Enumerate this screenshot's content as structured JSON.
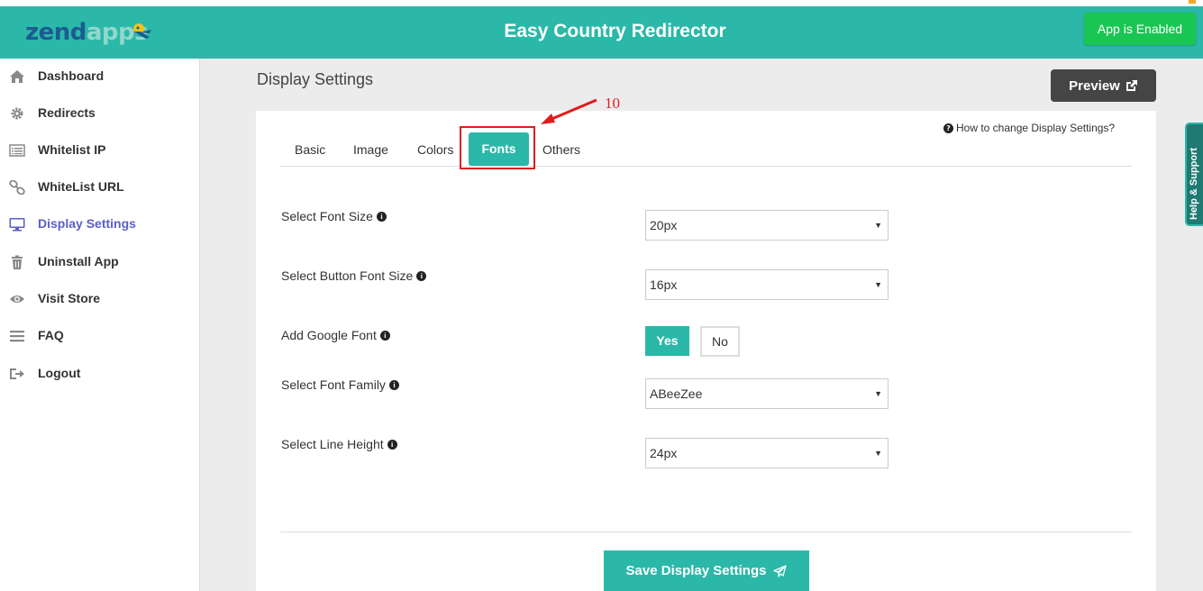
{
  "header": {
    "logo_part1": "zend",
    "logo_part2": "apps",
    "title": "Easy Country Redirector",
    "status_button": "App is Enabled"
  },
  "sidebar": {
    "items": [
      {
        "label": "Dashboard",
        "icon": "home-icon"
      },
      {
        "label": "Redirects",
        "icon": "gear-icon"
      },
      {
        "label": "Whitelist IP",
        "icon": "list-icon"
      },
      {
        "label": "WhiteList URL",
        "icon": "link-icon"
      },
      {
        "label": "Display Settings",
        "icon": "monitor-icon",
        "active": true
      },
      {
        "label": "Uninstall App",
        "icon": "trash-icon"
      },
      {
        "label": "Visit Store",
        "icon": "eye-icon"
      },
      {
        "label": "FAQ",
        "icon": "menu-icon"
      },
      {
        "label": "Logout",
        "icon": "logout-icon"
      }
    ]
  },
  "main": {
    "title": "Display Settings",
    "preview_label": "Preview",
    "help_link": "How to change Display Settings?",
    "tabs": [
      "Basic",
      "Image",
      "Colors",
      "Fonts",
      "Others"
    ],
    "active_tab": "Fonts",
    "annotation": "10",
    "fields": {
      "font_size": {
        "label": "Select Font Size",
        "value": "20px"
      },
      "button_font_size": {
        "label": "Select Button Font Size",
        "value": "16px"
      },
      "google_font": {
        "label": "Add Google Font",
        "yes": "Yes",
        "no": "No",
        "selected": "Yes"
      },
      "font_family": {
        "label": "Select Font Family",
        "value": "ABeeZee"
      },
      "line_height": {
        "label": "Select Line Height",
        "value": "24px"
      }
    },
    "save_label": "Save Display Settings"
  },
  "help_tab": "Help & Support",
  "colors": {
    "teal": "#2bb8a8",
    "enabled_green": "#19c653",
    "active_nav": "#5a5fc7",
    "annotation_red": "#e31b1b"
  }
}
